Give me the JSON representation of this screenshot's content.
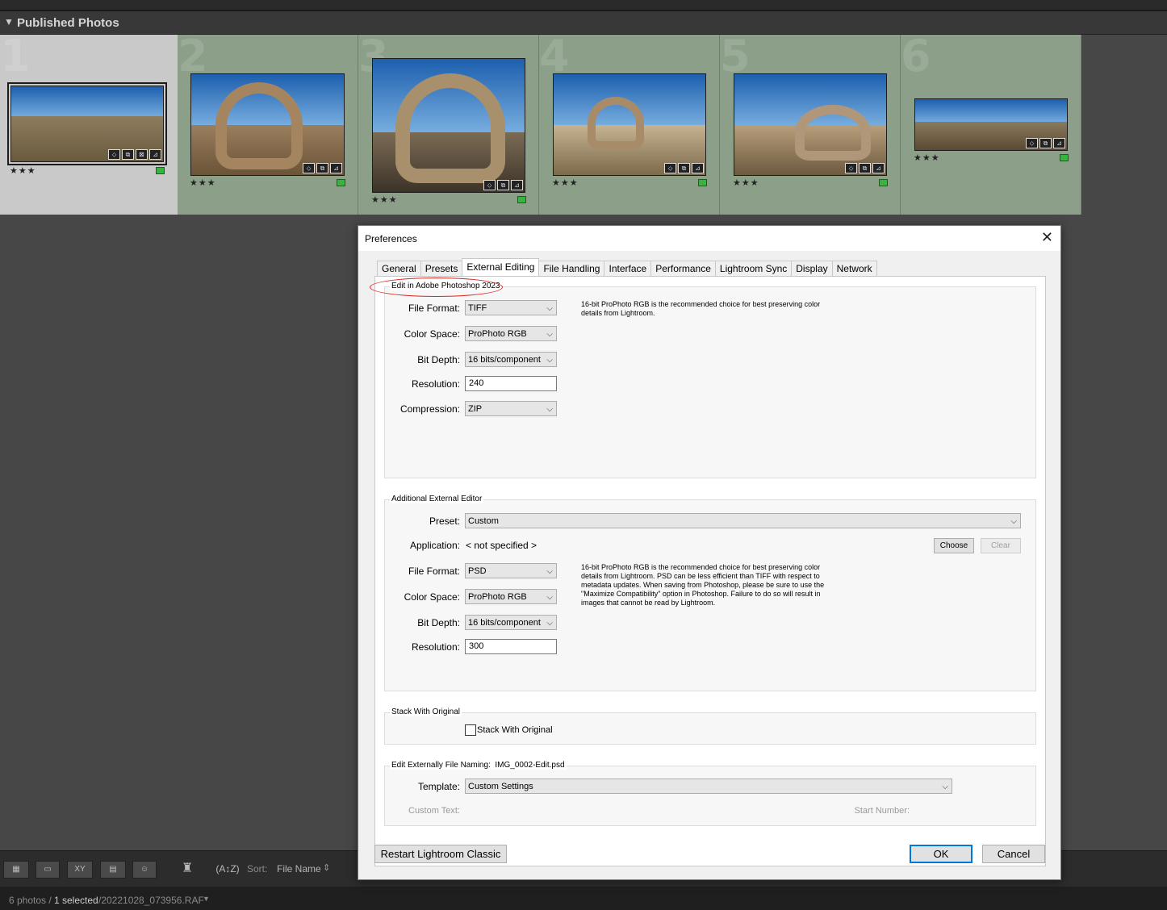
{
  "library": {
    "section_title": "Published Photos",
    "photos": [
      {
        "number": "1",
        "stars": "★★★",
        "selected": true
      },
      {
        "number": "2",
        "stars": "★★★",
        "selected": false
      },
      {
        "number": "3",
        "stars": "★★★",
        "selected": false
      },
      {
        "number": "4",
        "stars": "★★★",
        "selected": false
      },
      {
        "number": "5",
        "stars": "★★★",
        "selected": false
      },
      {
        "number": "6",
        "stars": "★★★",
        "selected": false
      }
    ],
    "toolbar": {
      "sort_label": "Sort:",
      "sort_value": "File Name",
      "icons": [
        "grid-view-icon",
        "loupe-view-icon",
        "compare-view-icon",
        "survey-view-icon",
        "people-view-icon",
        "spray-can-icon",
        "sort-direction-icon"
      ]
    },
    "status": {
      "count": "6 photos /",
      "selected": "1 selected",
      "filename": "/20221028_073956.RAF"
    }
  },
  "dialog": {
    "title": "Preferences",
    "tabs": [
      "General",
      "Presets",
      "External Editing",
      "File Handling",
      "Interface",
      "Performance",
      "Lightroom Sync",
      "Display",
      "Network"
    ],
    "active_tab": "External Editing",
    "photoshop": {
      "group_label": "Edit in Adobe Photoshop 2023",
      "file_format_label": "File Format:",
      "file_format": "TIFF",
      "color_space_label": "Color Space:",
      "color_space": "ProPhoto RGB",
      "bit_depth_label": "Bit Depth:",
      "bit_depth": "16 bits/component",
      "resolution_label": "Resolution:",
      "resolution": "240",
      "compression_label": "Compression:",
      "compression": "ZIP",
      "note": "16-bit ProPhoto RGB is the recommended choice for best preserving color details from Lightroom."
    },
    "additional": {
      "group_label": "Additional External Editor",
      "preset_label": "Preset:",
      "preset": "Custom",
      "application_label": "Application:",
      "application": "< not specified >",
      "choose_button": "Choose",
      "clear_button": "Clear",
      "file_format_label": "File Format:",
      "file_format": "PSD",
      "color_space_label": "Color Space:",
      "color_space": "ProPhoto RGB",
      "bit_depth_label": "Bit Depth:",
      "bit_depth": "16 bits/component",
      "resolution_label": "Resolution:",
      "resolution": "300",
      "note": "16-bit ProPhoto RGB is the recommended choice for best preserving color details from Lightroom. PSD can be less efficient than TIFF with respect to metadata updates. When saving from Photoshop, please be sure to use the \"Maximize Compatibility\" option in Photoshop. Failure to do so will result in images that cannot be read by Lightroom."
    },
    "stack": {
      "group_label": "Stack With Original",
      "checkbox_label": "Stack With Original",
      "checked": false
    },
    "naming": {
      "group_label": "Edit Externally File Naming:",
      "example": "IMG_0002-Edit.psd",
      "template_label": "Template:",
      "template": "Custom Settings",
      "custom_text_label": "Custom Text:",
      "start_number_label": "Start Number:"
    },
    "restart_button": "Restart Lightroom Classic",
    "ok_button": "OK",
    "cancel_button": "Cancel",
    "annotation_color": "#d9251d"
  }
}
